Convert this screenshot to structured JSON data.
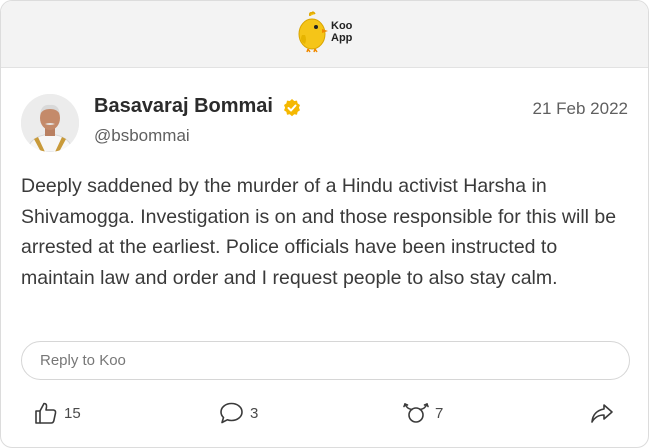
{
  "app": {
    "logo_line1": "Koo",
    "logo_line2": "App",
    "brand_yellow": "#F5C518"
  },
  "post": {
    "author_name": "Basavaraj Bommai",
    "verified": true,
    "handle": "@bsbommai",
    "date": "21 Feb 2022",
    "text": "Deeply saddened by the murder of a Hindu activist Harsha in Shivamogga. Investigation is on and those responsible for this will be arrested at the earliest. Police officials have been instructed to maintain law and order and I request people to also stay calm."
  },
  "reply": {
    "placeholder": "Reply to Koo"
  },
  "actions": {
    "likes": "15",
    "comments": "3",
    "rekoos": "7"
  },
  "icons": {
    "logo": "koo-bird-icon",
    "verified": "verified-badge-icon",
    "like": "thumbs-up-icon",
    "comment": "comment-icon",
    "rekoo": "rekoo-icon",
    "share": "share-arrow-icon"
  }
}
